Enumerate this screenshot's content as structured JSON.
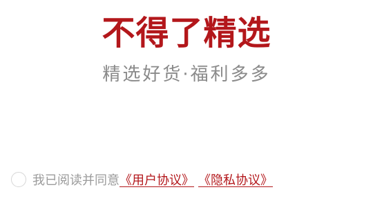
{
  "brand": {
    "title": "不得了精选",
    "slogan": "精选好货·福利多多",
    "accent_color": "#b3171b"
  },
  "agreement": {
    "checkbox_checked": false,
    "consent_text": "我已阅读并同意",
    "user_agreement_link": "《用户协议》",
    "privacy_policy_link": "《隐私协议》"
  }
}
